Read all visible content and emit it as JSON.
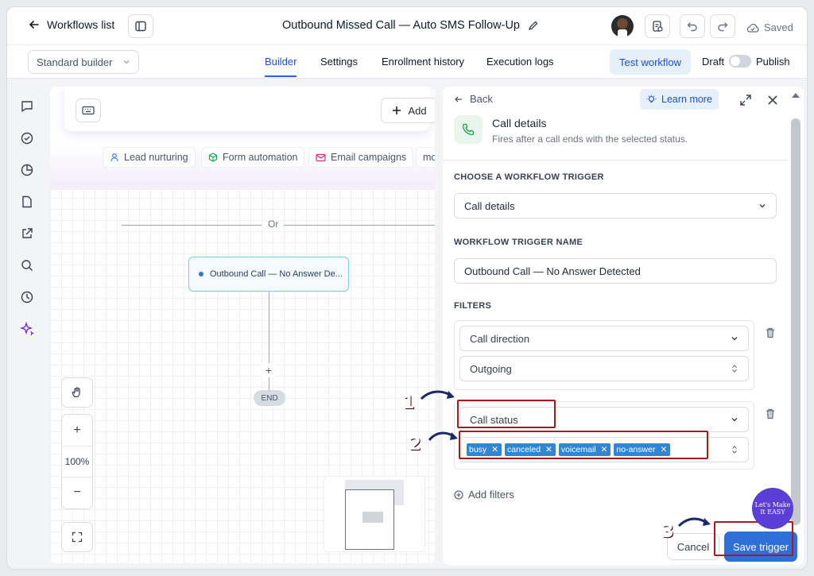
{
  "topbar": {
    "back_label": "Workflows list",
    "workflow_title": "Outbound Missed Call — Auto SMS Follow-Up",
    "saved_label": "Saved"
  },
  "subbar": {
    "builder_mode": "Standard builder",
    "tabs": [
      {
        "label": "Builder",
        "active": true
      },
      {
        "label": "Settings",
        "active": false
      },
      {
        "label": "Enrollment history",
        "active": false
      },
      {
        "label": "Execution logs",
        "active": false
      }
    ],
    "test_button": "Test workflow",
    "draft_label": "Draft",
    "publish_label": "Publish"
  },
  "canvas": {
    "add_label": "Add",
    "chips": [
      "Lead nurturing",
      "Form automation",
      "Email campaigns",
      "mo"
    ],
    "or_label": "Or",
    "trigger_node": "Outbound Call — No Answer De...",
    "plus": "+",
    "end_label": "END",
    "zoom_level": "100%",
    "zoom_in": "+",
    "zoom_out": "−"
  },
  "panel": {
    "back_label": "Back",
    "learn_more": "Learn more",
    "trigger_title": "Call details",
    "trigger_subtitle": "Fires after a call ends with the selected status.",
    "choose_label": "CHOOSE A WORKFLOW TRIGGER",
    "trigger_value": "Call details",
    "name_label": "WORKFLOW TRIGGER NAME",
    "name_value": "Outbound Call — No Answer Detected",
    "filters_label": "FILTERS",
    "filter1": {
      "field": "Call direction",
      "value": "Outgoing"
    },
    "filter2": {
      "field": "Call status",
      "tags": [
        "busy",
        "canceled",
        "voicemail",
        "no-answer"
      ]
    },
    "add_filters": "Add filters",
    "cancel_label": "Cancel",
    "save_label": "Save trigger"
  },
  "annotations": {
    "step1": "1",
    "step2": "2",
    "step3": "3",
    "watermark": "Let's Make It EASY",
    "highlight_color": "#a61c1c"
  },
  "colors": {
    "accent": "#2f6fd8",
    "tag": "#2f86d6",
    "node_border": "#7cc7e8"
  }
}
